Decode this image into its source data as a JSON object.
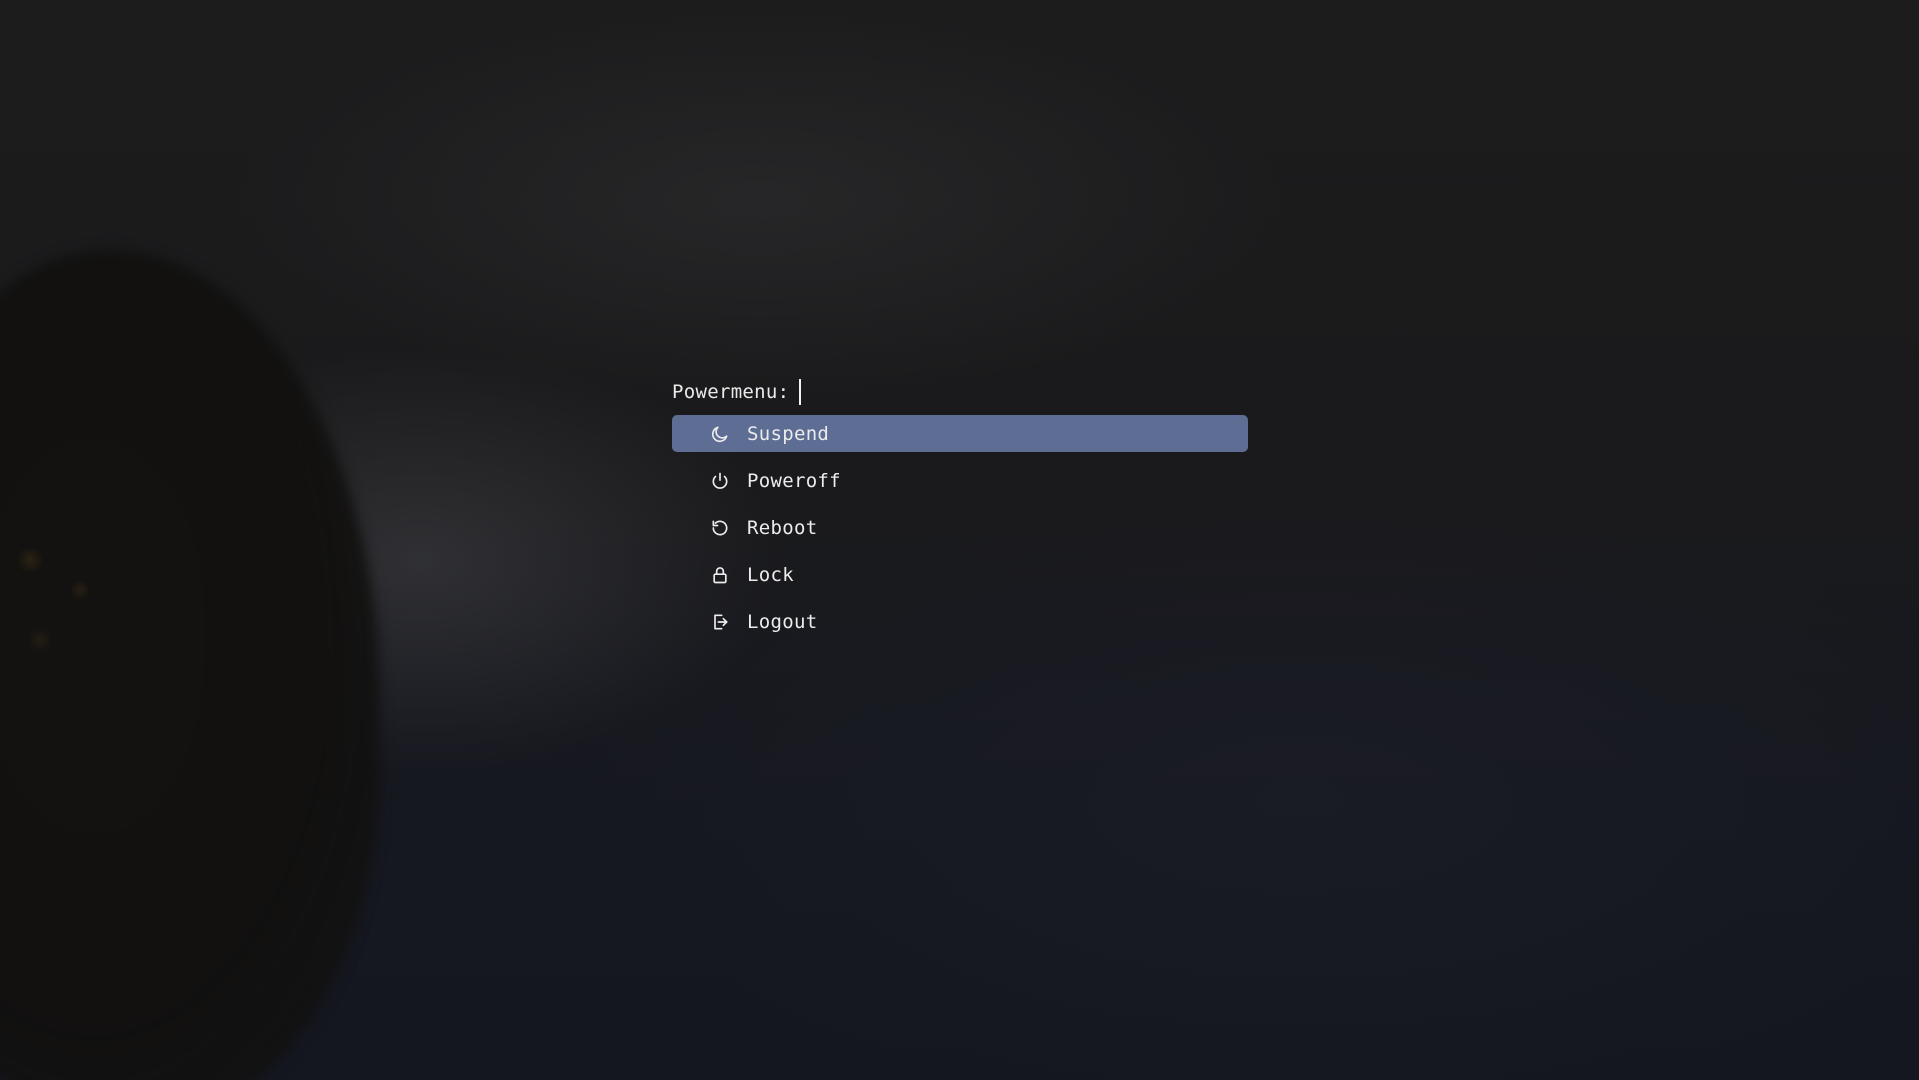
{
  "prompt": {
    "label": "Powermenu:"
  },
  "menu": {
    "items": [
      {
        "label": "Suspend",
        "icon": "moon-icon",
        "selected": true
      },
      {
        "label": "Poweroff",
        "icon": "power-icon",
        "selected": false
      },
      {
        "label": "Reboot",
        "icon": "reboot-icon",
        "selected": false
      },
      {
        "label": "Lock",
        "icon": "lock-icon",
        "selected": false
      },
      {
        "label": "Logout",
        "icon": "logout-icon",
        "selected": false
      }
    ]
  },
  "colors": {
    "selection": "#5d6d94",
    "text": "#ececec",
    "background": "#17181b"
  }
}
